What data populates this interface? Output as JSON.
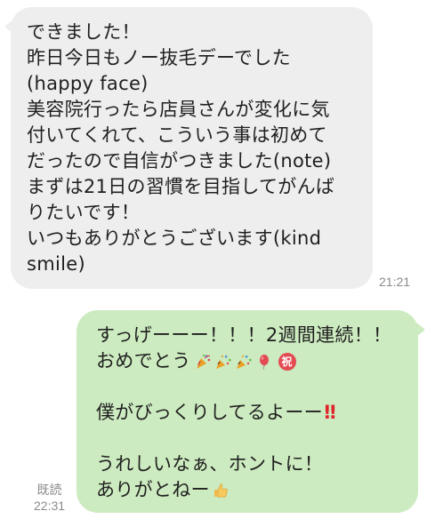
{
  "received": {
    "lines": [
      "できました！",
      "昨日今日もノー抜毛デーでした",
      "(happy face)",
      "美容院行ったら店員さんが変化に気",
      "付いてくれて、こういう事は初めて",
      "だったので自信がつきました(note)",
      "まずは21日の習慣を目指してがんば",
      "りたいです！",
      "いつもありがとうございます(kind",
      "smile)"
    ],
    "time": "21:21"
  },
  "sent": {
    "line1": "すっげーーー！！！2週間連続！！",
    "line2": "おめでとう",
    "line2_badge": "祝",
    "line3": "僕がびっくりしてるよーー",
    "line3_mark": "!!",
    "line4": "うれしいなぁ、ホントに！",
    "line5": "ありがとねー",
    "read_label": "既読",
    "time": "22:31",
    "emoji_icons": [
      "party-popper-icon",
      "confetti-icon",
      "confetti-icon",
      "balloon-icon",
      "celebration-badge-icon"
    ],
    "thumb_icon": "thumbs-up-icon"
  },
  "colors": {
    "received_bubble": "#eeeeee",
    "sent_bubble": "#cdebc0",
    "meta_text": "#8a8a8a",
    "accent_red": "#e0242c"
  }
}
